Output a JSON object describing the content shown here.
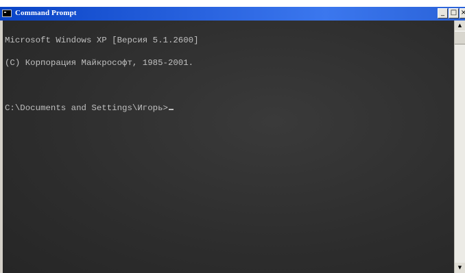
{
  "window": {
    "title": "Command Prompt",
    "controls": {
      "minimize_glyph": "_",
      "maximize_glyph": "□",
      "close_glyph": "×"
    }
  },
  "console": {
    "lines": [
      "Microsoft Windows XP [Версия 5.1.2600]",
      "(C) Корпорация Майкрософт, 1985-2001."
    ],
    "prompt": "C:\\Documents and Settings\\Игорь>"
  },
  "scrollbar": {
    "up_glyph": "▲",
    "down_glyph": "▼"
  },
  "colors": {
    "titlebar": "#2a64e0",
    "console_background": "#313131",
    "console_text": "#c0c0c0"
  },
  "icons": {
    "app": "console-icon",
    "minimize": "minimize-icon",
    "maximize": "maximize-icon",
    "close": "close-icon"
  }
}
